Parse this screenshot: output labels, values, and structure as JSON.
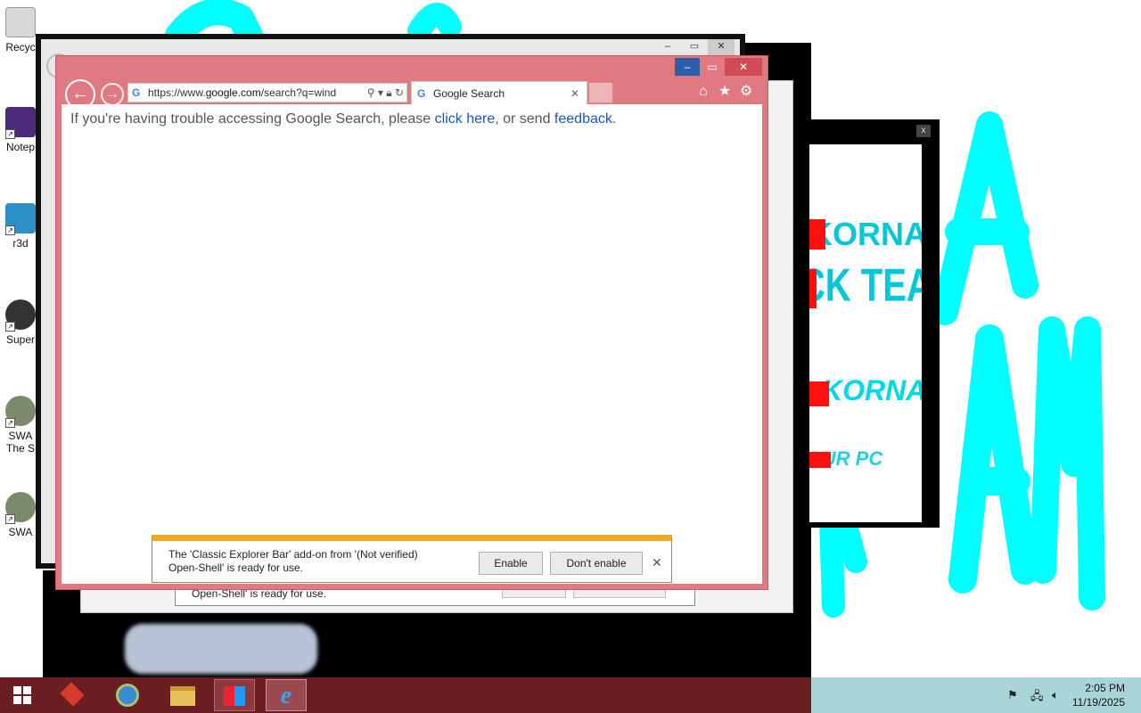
{
  "desktop": {
    "icons": [
      {
        "label": "Recyc",
        "icon": "recycle-bin-icon"
      },
      {
        "label": "Notep",
        "icon": "notepad-icon"
      },
      {
        "label": "r3d",
        "icon": "r3d-icon"
      },
      {
        "label": "Super",
        "icon": "super-icon"
      },
      {
        "label": "SWA",
        "label2": "The S",
        "icon": "swa-icon"
      },
      {
        "label": "SWA",
        "icon": "swa-icon"
      }
    ]
  },
  "malware_window": {
    "lines": [
      "KORNA",
      "ACK TEAM",
      "KORNA",
      "YOUR PC"
    ],
    "close": "x"
  },
  "browser": {
    "address": "https://www.google.com/search?q=wind",
    "address_prefix": "https://www.",
    "address_domain": "google.com",
    "address_rest": "/search?q=wind",
    "tab_title": "Google Search",
    "content": {
      "prefix": "If you're having trouble accessing Google Search, please ",
      "link1": "click here",
      "middle": ", or send ",
      "link2": "feedback",
      "suffix": "."
    }
  },
  "notification": {
    "line1": "The 'Classic Explorer Bar' add-on from '(Not verified)",
    "line2": "Open-Shell' is ready for use.",
    "enable": "Enable",
    "dont_enable": "Don't enable",
    "back_line": "Open-Shell' is ready for use."
  },
  "taskbar": {
    "time": "2:05 PM",
    "date": "11/19/2025"
  },
  "colors": {
    "ie_frame": "#e07a80",
    "taskbar_dark": "#6b1e22",
    "taskbar_light": "#a8d6d8",
    "art_cyan": "#00ffff",
    "notif_accent": "#f2aa24"
  }
}
